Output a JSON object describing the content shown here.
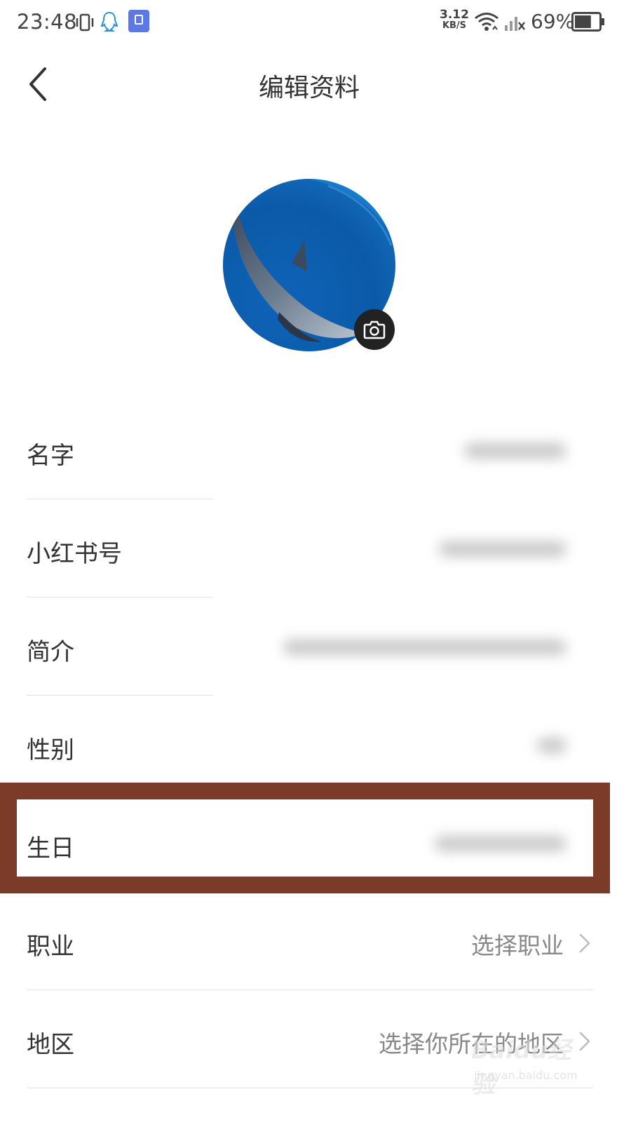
{
  "status_bar": {
    "time": "23:48",
    "speed_value": "3.12",
    "speed_unit": "KB/S",
    "battery_percent": "69%",
    "battery_level": 0.69
  },
  "header": {
    "title": "编辑资料",
    "back_icon": "chevron-left-icon"
  },
  "avatar": {
    "camera_icon": "camera-icon"
  },
  "form": {
    "rows": [
      {
        "label": "名字",
        "value": ""
      },
      {
        "label": "小红书号",
        "value": ""
      },
      {
        "label": "简介",
        "value": ""
      },
      {
        "label": "性别",
        "value": ""
      },
      {
        "label": "生日",
        "value": ""
      },
      {
        "label": "职业",
        "value": "选择职业"
      },
      {
        "label": "地区",
        "value": "选择你所在的地区"
      }
    ]
  },
  "highlight": {
    "color": "#7c3a28",
    "target": "生日"
  },
  "watermark": {
    "main": "Baidu经验",
    "sub": "jingyan.baidu.com"
  }
}
